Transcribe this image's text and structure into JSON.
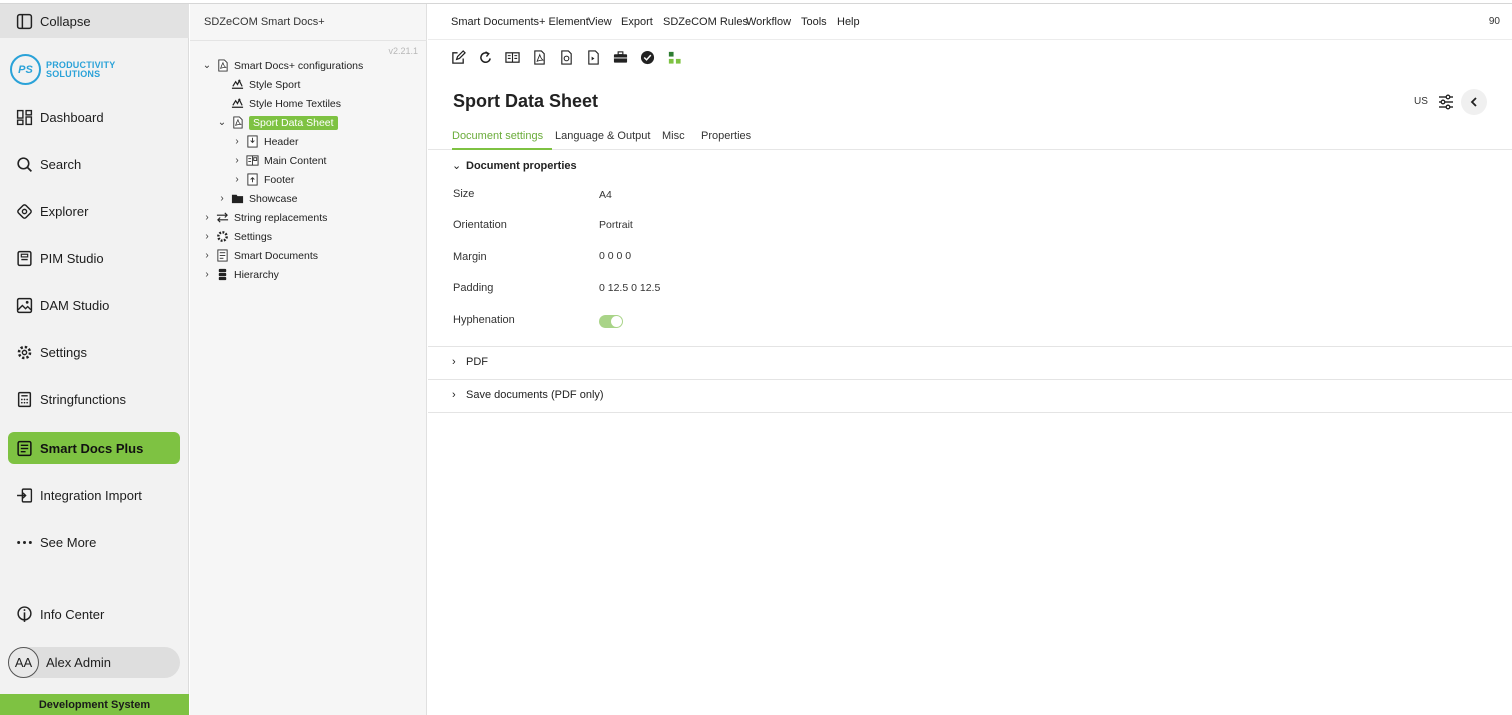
{
  "nav": {
    "collapse_label": "Collapse",
    "logo": {
      "mark": "PS",
      "line1": "PRODUCTIVITY",
      "line2": "SOLUTIONS"
    },
    "items": [
      {
        "label": "Dashboard",
        "icon": "dashboard-icon"
      },
      {
        "label": "Search",
        "icon": "search-icon"
      },
      {
        "label": "Explorer",
        "icon": "explorer-icon"
      },
      {
        "label": "PIM Studio",
        "icon": "pim-studio-icon"
      },
      {
        "label": "DAM Studio",
        "icon": "dam-studio-icon"
      },
      {
        "label": "Settings",
        "icon": "gear-icon"
      },
      {
        "label": "Stringfunctions",
        "icon": "calculator-icon"
      },
      {
        "label": "Smart Docs Plus",
        "icon": "smart-docs-icon",
        "active": true
      },
      {
        "label": "Integration Import",
        "icon": "import-icon"
      },
      {
        "label": "See More",
        "icon": "more-dots-icon"
      }
    ],
    "info_center": "Info Center",
    "user": {
      "initials": "AA",
      "name": "Alex Admin"
    },
    "environment": "Development System"
  },
  "tree": {
    "title": "SDZeCOM Smart Docs+",
    "version": "v2.21.1",
    "nodes": [
      {
        "label": "Smart Docs+ configurations",
        "chev": "⌄",
        "icon": "pdf-icon"
      },
      {
        "label": "Style Sport",
        "chev": "",
        "icon": "style-icon"
      },
      {
        "label": "Style Home Textiles",
        "chev": "",
        "icon": "style-icon"
      },
      {
        "label": "Sport Data Sheet",
        "chev": "⌄",
        "icon": "pdf-icon",
        "selected": true
      },
      {
        "label": "Header",
        "chev": "›",
        "icon": "header-icon"
      },
      {
        "label": "Main Content",
        "chev": "›",
        "icon": "content-icon"
      },
      {
        "label": "Footer",
        "chev": "›",
        "icon": "footer-icon"
      },
      {
        "label": "Showcase",
        "chev": "›",
        "icon": "folder-icon"
      },
      {
        "label": "String replacements",
        "chev": "›",
        "icon": "swap-icon"
      },
      {
        "label": "Settings",
        "chev": "›",
        "icon": "gear-icon"
      },
      {
        "label": "Smart Documents",
        "chev": "›",
        "icon": "document-icon"
      },
      {
        "label": "Hierarchy",
        "chev": "›",
        "icon": "database-icon"
      }
    ]
  },
  "menubar": {
    "items": [
      "Smart Documents+ Element",
      "View",
      "Export",
      "SDZeCOM Rules",
      "Workflow",
      "Tools",
      "Help"
    ],
    "right_text": "90"
  },
  "toolbar": {
    "icons": [
      "edit-icon",
      "reload-icon",
      "compare-icon",
      "pdf-export-icon",
      "preview-icon",
      "publish-icon",
      "briefcase-icon",
      "check-circle-icon",
      "hierarchy-icon"
    ]
  },
  "document": {
    "title": "Sport Data Sheet",
    "language": "US",
    "tabs": [
      "Document settings",
      "Language & Output",
      "Misc",
      "Properties"
    ],
    "sections": {
      "properties_title": "Document properties",
      "props": [
        {
          "label": "Size",
          "value": "A4"
        },
        {
          "label": "Orientation",
          "value": "Portrait"
        },
        {
          "label": "Margin",
          "value": "0 0 0 0"
        },
        {
          "label": "Padding",
          "value": "0 12.5 0 12.5"
        },
        {
          "label": "Hyphenation",
          "value": ""
        }
      ],
      "hyphenation_on": true,
      "pdf_title": "PDF",
      "save_title": "Save documents (PDF only)"
    }
  },
  "colors": {
    "accent": "#7ec242",
    "logo": "#2aa2d8"
  }
}
